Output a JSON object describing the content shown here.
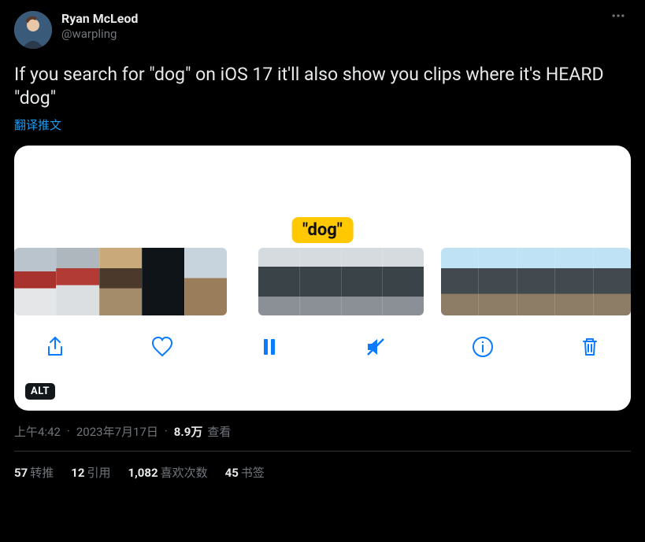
{
  "author": {
    "display_name": "Ryan McLeod",
    "handle": "@warpling"
  },
  "tweet_text": "If you search for \"dog\" on iOS 17 it'll also show you clips where it's HEARD \"dog\"",
  "translate_label": "翻译推文",
  "media": {
    "search_chip": "\"dog\"",
    "alt_badge": "ALT",
    "toolbar_icons": {
      "share": "share-icon",
      "heart": "heart-icon",
      "pause": "pause-icon",
      "mute": "mute-icon",
      "info": "info-icon",
      "trash": "trash-icon"
    }
  },
  "meta": {
    "time": "上午4:42",
    "date": "2023年7月17日",
    "views_count": "8.9万",
    "views_label": "查看"
  },
  "stats": {
    "retweets": {
      "count": "57",
      "label": "转推"
    },
    "quotes": {
      "count": "12",
      "label": "引用"
    },
    "likes": {
      "count": "1,082",
      "label": "喜欢次数"
    },
    "bookmarks": {
      "count": "45",
      "label": "书签"
    }
  }
}
